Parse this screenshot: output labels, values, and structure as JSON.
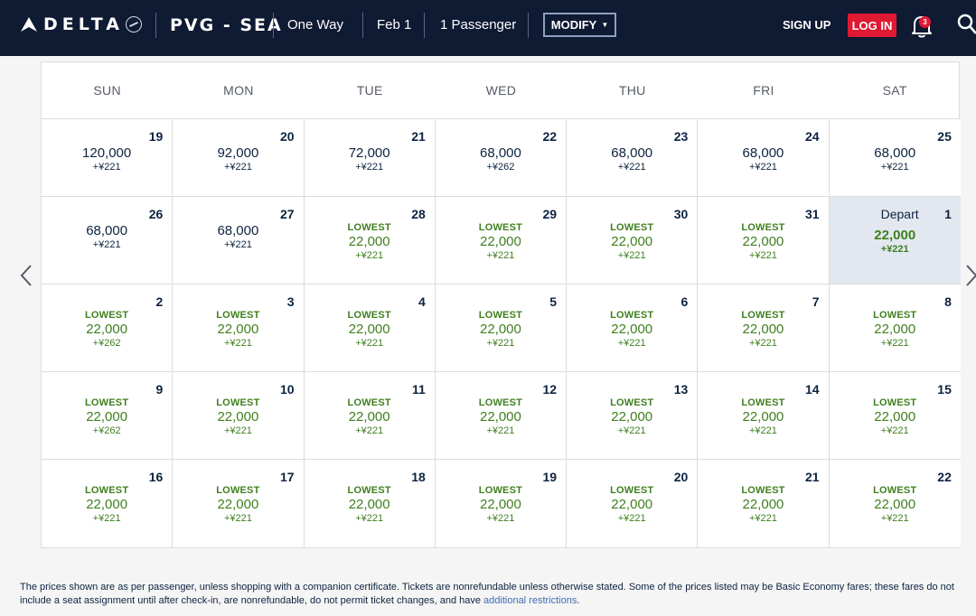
{
  "header": {
    "brand": "DELTA",
    "route": "PVG - SEA",
    "trip_type": "One Way",
    "date": "Feb 1",
    "passengers": "1 Passenger",
    "modify_label": "MODIFY",
    "signup_label": "SIGN UP",
    "login_label": "LOG IN",
    "notification_count": "3"
  },
  "colors": {
    "header_bg": "#0f1a33",
    "login_red": "#e01933",
    "lowest_green": "#3f7f1e",
    "selected_bg": "#e3e8f0",
    "text_navy": "#0c2340"
  },
  "calendar": {
    "weekdays": [
      "SUN",
      "MON",
      "TUE",
      "WED",
      "THU",
      "FRI",
      "SAT"
    ],
    "weeks": [
      [
        {
          "day": "19",
          "miles": "120,000",
          "tax": "+¥221"
        },
        {
          "day": "20",
          "miles": "92,000",
          "tax": "+¥221"
        },
        {
          "day": "21",
          "miles": "72,000",
          "tax": "+¥221"
        },
        {
          "day": "22",
          "miles": "68,000",
          "tax": "+¥262"
        },
        {
          "day": "23",
          "miles": "68,000",
          "tax": "+¥221"
        },
        {
          "day": "24",
          "miles": "68,000",
          "tax": "+¥221"
        },
        {
          "day": "25",
          "miles": "68,000",
          "tax": "+¥221"
        }
      ],
      [
        {
          "day": "26",
          "miles": "68,000",
          "tax": "+¥221"
        },
        {
          "day": "27",
          "miles": "68,000",
          "tax": "+¥221"
        },
        {
          "day": "28",
          "label": "LOWEST",
          "miles": "22,000",
          "tax": "+¥221"
        },
        {
          "day": "29",
          "label": "LOWEST",
          "miles": "22,000",
          "tax": "+¥221"
        },
        {
          "day": "30",
          "label": "LOWEST",
          "miles": "22,000",
          "tax": "+¥221"
        },
        {
          "day": "31",
          "label": "LOWEST",
          "miles": "22,000",
          "tax": "+¥221"
        },
        {
          "day": "1",
          "depart": "Depart",
          "miles": "22,000",
          "tax": "+¥221",
          "selected": true
        }
      ],
      [
        {
          "day": "2",
          "label": "LOWEST",
          "miles": "22,000",
          "tax": "+¥262"
        },
        {
          "day": "3",
          "label": "LOWEST",
          "miles": "22,000",
          "tax": "+¥221"
        },
        {
          "day": "4",
          "label": "LOWEST",
          "miles": "22,000",
          "tax": "+¥221"
        },
        {
          "day": "5",
          "label": "LOWEST",
          "miles": "22,000",
          "tax": "+¥221"
        },
        {
          "day": "6",
          "label": "LOWEST",
          "miles": "22,000",
          "tax": "+¥221"
        },
        {
          "day": "7",
          "label": "LOWEST",
          "miles": "22,000",
          "tax": "+¥221"
        },
        {
          "day": "8",
          "label": "LOWEST",
          "miles": "22,000",
          "tax": "+¥221"
        }
      ],
      [
        {
          "day": "9",
          "label": "LOWEST",
          "miles": "22,000",
          "tax": "+¥262"
        },
        {
          "day": "10",
          "label": "LOWEST",
          "miles": "22,000",
          "tax": "+¥221"
        },
        {
          "day": "11",
          "label": "LOWEST",
          "miles": "22,000",
          "tax": "+¥221"
        },
        {
          "day": "12",
          "label": "LOWEST",
          "miles": "22,000",
          "tax": "+¥221"
        },
        {
          "day": "13",
          "label": "LOWEST",
          "miles": "22,000",
          "tax": "+¥221"
        },
        {
          "day": "14",
          "label": "LOWEST",
          "miles": "22,000",
          "tax": "+¥221"
        },
        {
          "day": "15",
          "label": "LOWEST",
          "miles": "22,000",
          "tax": "+¥221"
        }
      ],
      [
        {
          "day": "16",
          "label": "LOWEST",
          "miles": "22,000",
          "tax": "+¥221"
        },
        {
          "day": "17",
          "label": "LOWEST",
          "miles": "22,000",
          "tax": "+¥221"
        },
        {
          "day": "18",
          "label": "LOWEST",
          "miles": "22,000",
          "tax": "+¥221"
        },
        {
          "day": "19",
          "label": "LOWEST",
          "miles": "22,000",
          "tax": "+¥221"
        },
        {
          "day": "20",
          "label": "LOWEST",
          "miles": "22,000",
          "tax": "+¥221"
        },
        {
          "day": "21",
          "label": "LOWEST",
          "miles": "22,000",
          "tax": "+¥221"
        },
        {
          "day": "22",
          "label": "LOWEST",
          "miles": "22,000",
          "tax": "+¥221"
        }
      ]
    ]
  },
  "icons": {
    "prev": "chevron-left-icon",
    "next": "chevron-right-icon",
    "bell": "bell-icon",
    "search": "search-icon"
  },
  "footer": {
    "disclaimer": "The prices shown are as per passenger, unless shopping with a companion certificate. Tickets are nonrefundable unless otherwise stated. Some of the prices listed may be Basic Economy fares; these fares do not include a seat assignment until after check-in, are nonrefundable, do not permit ticket changes, and have ",
    "link_text": "additional restrictions",
    "end": "."
  }
}
